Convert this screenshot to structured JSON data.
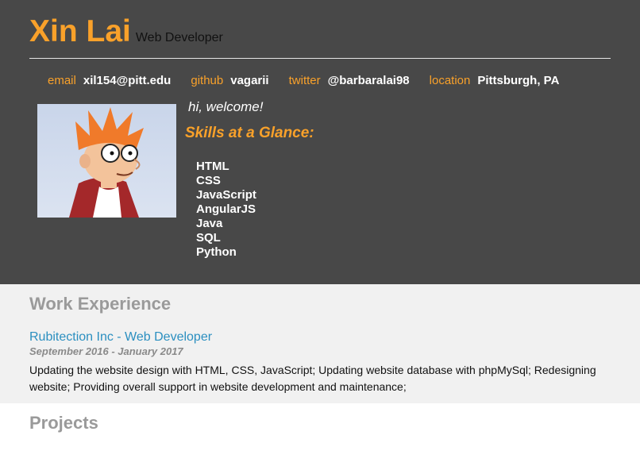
{
  "profile": {
    "name": "Xin Lai",
    "role": "Web Developer"
  },
  "contacts": [
    {
      "key": "email",
      "value": "xil154@pitt.edu"
    },
    {
      "key": "github",
      "value": "vagarii"
    },
    {
      "key": "twitter",
      "value": "@barbaralai98"
    },
    {
      "key": "location",
      "value": "Pittsburgh, PA"
    }
  ],
  "intro": {
    "welcome": "hi, welcome!",
    "skills_title": "Skills at a Glance:",
    "skills": [
      "HTML",
      "CSS",
      "JavaScript",
      "AngularJS",
      "Java",
      "SQL",
      "Python"
    ],
    "avatar_icon": "cartoon-avatar"
  },
  "work": {
    "title": "Work Experience",
    "jobs": [
      {
        "title": "Rubitection Inc - Web Developer",
        "dates": "September 2016 - January 2017",
        "description": "Updating the website design with HTML, CSS, JavaScript; Updating website database with phpMySql; Redesigning website; Providing overall support in website development and maintenance;"
      }
    ]
  },
  "projects": {
    "title": "Projects"
  },
  "colors": {
    "accent": "#f9a12a",
    "header_bg": "#484848",
    "link": "#2b8fc0"
  }
}
